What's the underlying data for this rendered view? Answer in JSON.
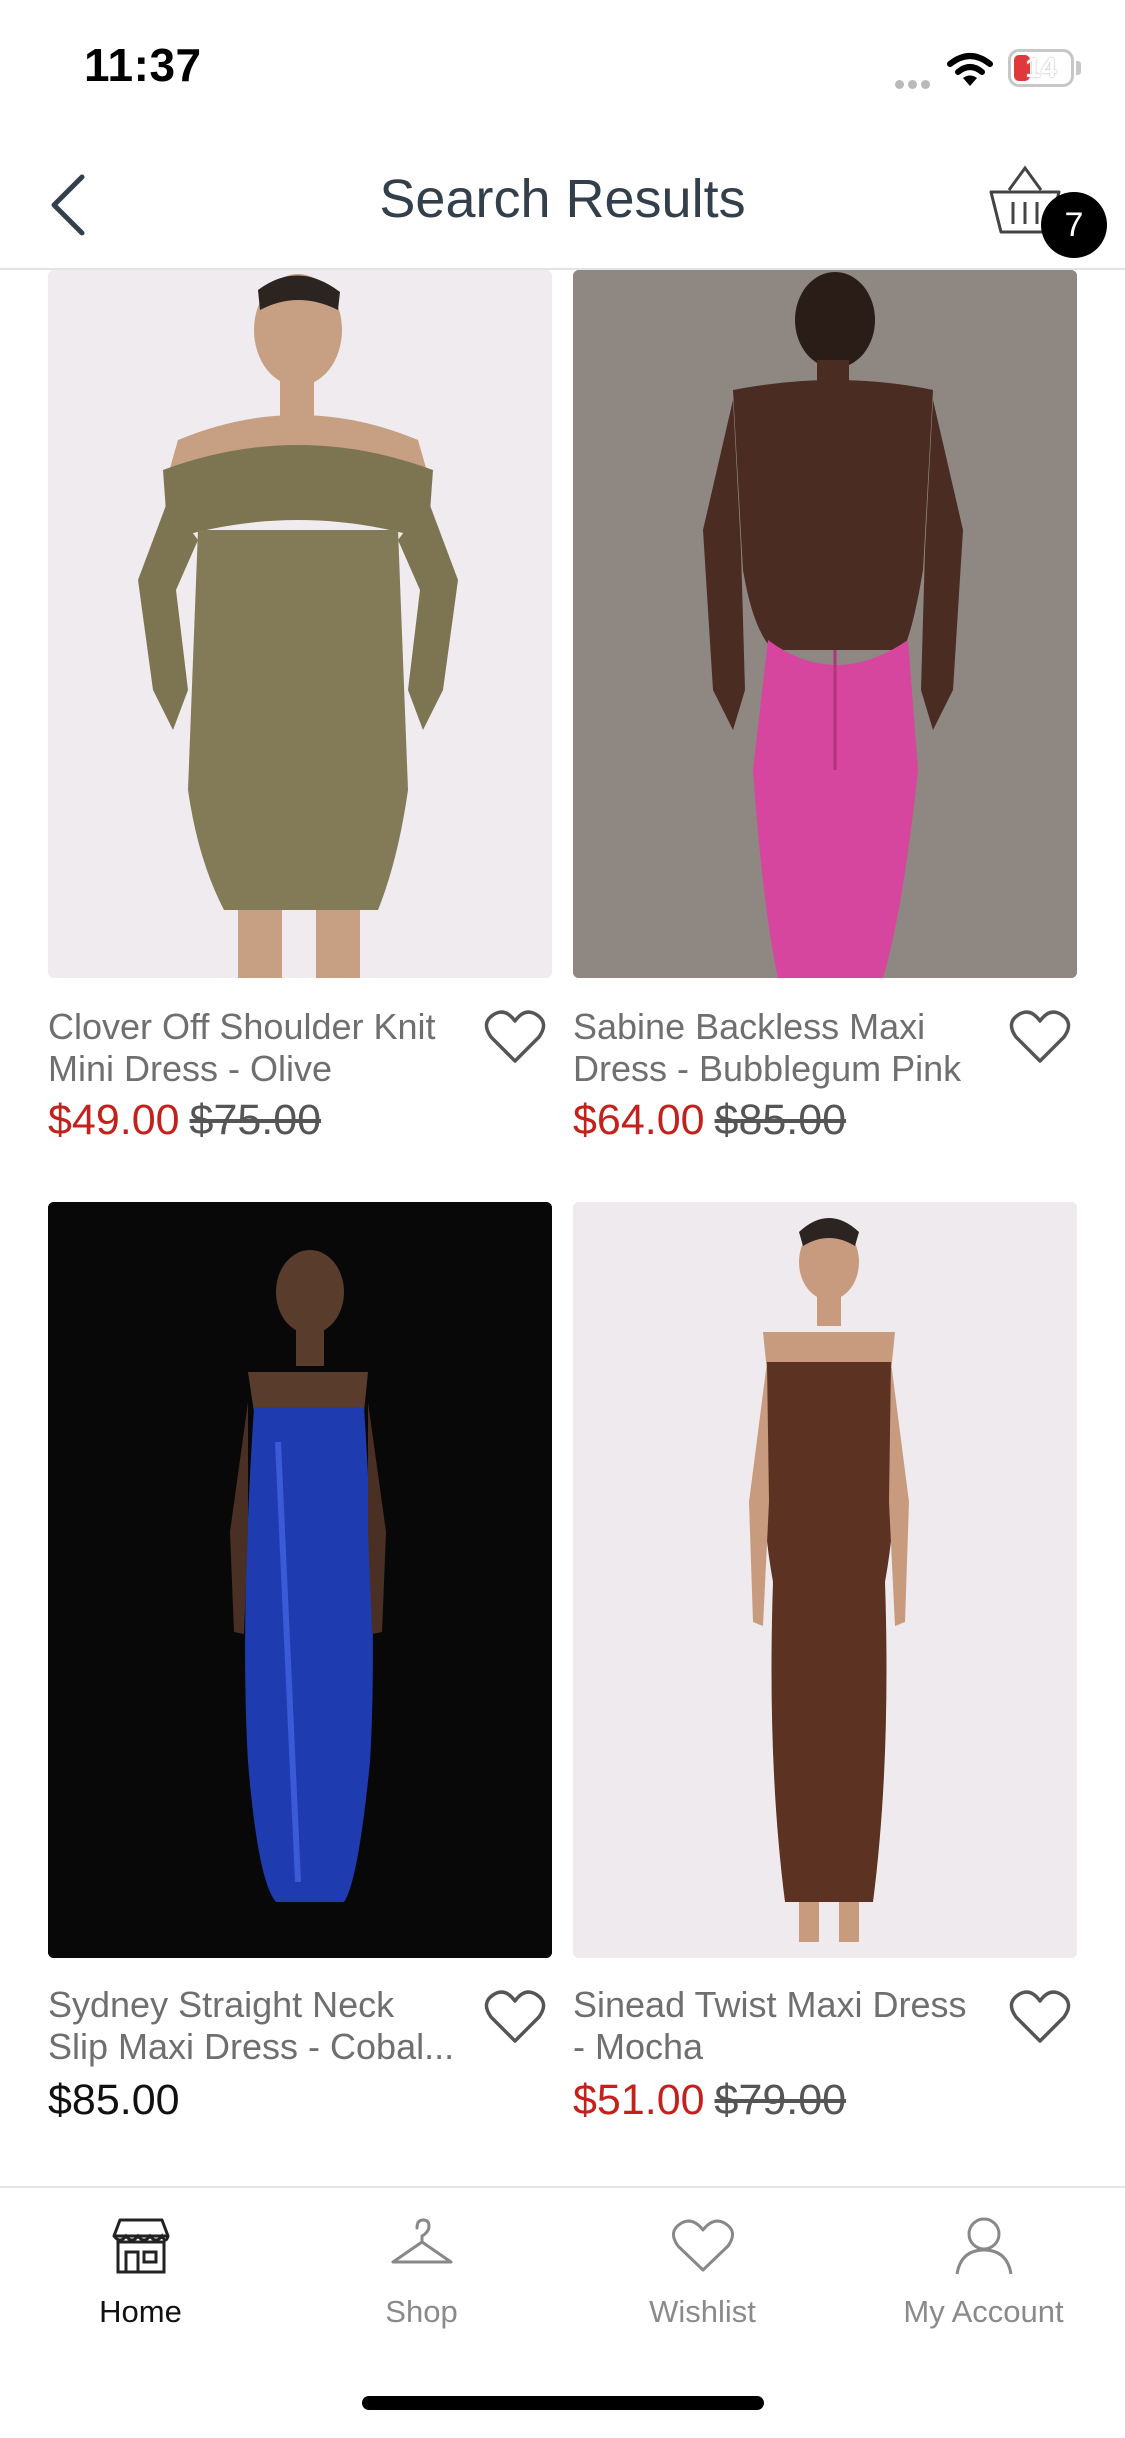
{
  "status_bar": {
    "time": "11:37",
    "battery": "14"
  },
  "header": {
    "title": "Search Results",
    "cart_count": "7"
  },
  "products": [
    {
      "name_line1": "Clover Off Shoulder Knit",
      "name_line2": "Mini Dress - Olive",
      "price": "$49.00",
      "original_price": "$75.00",
      "image": "olive-off-shoulder-dress-photo"
    },
    {
      "name_line1": "Sabine Backless Maxi",
      "name_line2": "Dress - Bubblegum Pink",
      "price": "$64.00",
      "original_price": "$85.00",
      "image": "pink-backless-maxi-dress-photo"
    },
    {
      "name_line1": "Sydney Straight Neck",
      "name_line2": "Slip Maxi Dress - Cobal...",
      "price": "$85.00",
      "original_price": "",
      "image": "cobalt-slip-maxi-dress-photo"
    },
    {
      "name_line1": "Sinead Twist Maxi Dress",
      "name_line2": "- Mocha",
      "price": "$51.00",
      "original_price": "$79.00",
      "image": "mocha-twist-maxi-dress-photo"
    }
  ],
  "tab_bar": {
    "items": [
      {
        "label": "Home",
        "icon": "storefront-icon",
        "active": true
      },
      {
        "label": "Shop",
        "icon": "hanger-icon",
        "active": false
      },
      {
        "label": "Wishlist",
        "icon": "heart-icon",
        "active": false
      },
      {
        "label": "My Account",
        "icon": "person-icon",
        "active": false
      }
    ]
  },
  "colors": {
    "sale_price": "#c4211d",
    "title": "#333f4a",
    "badge": "#000000"
  }
}
